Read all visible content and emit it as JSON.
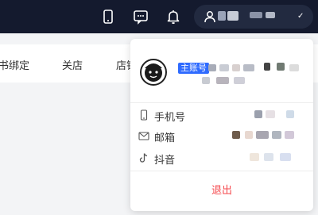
{
  "topbar": {
    "icons": [
      "phone-icon",
      "chat-icon",
      "bell-icon",
      "user-icon"
    ],
    "account_menu_caret": "✓"
  },
  "tabs": [
    {
      "label": "书绑定"
    },
    {
      "label": "关店"
    },
    {
      "label": "店铺"
    }
  ],
  "account_menu": {
    "main_account_badge": "主账号",
    "rows": [
      {
        "icon": "phone-icon",
        "label": "手机号"
      },
      {
        "icon": "mail-icon",
        "label": "邮箱"
      },
      {
        "icon": "douyin-icon",
        "label": "抖音"
      }
    ],
    "logout_label": "退出"
  },
  "colors": {
    "topbar": "#141a2e",
    "badge": "#2f6bff",
    "logout": "#f5484d"
  }
}
